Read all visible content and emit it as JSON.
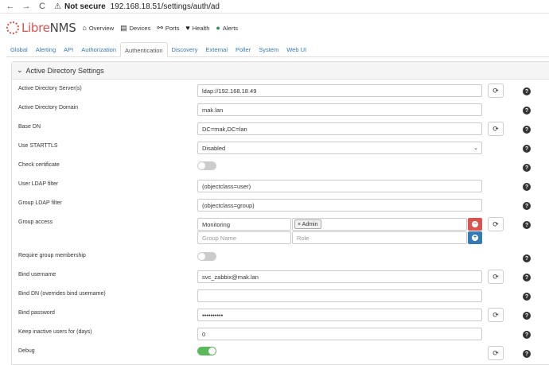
{
  "browser": {
    "back": "←",
    "forward": "→",
    "reload": "C",
    "warning_icon": "warning-icon",
    "not_secure": "Not secure",
    "url": "192.168.18.51/settings/auth/ad"
  },
  "navbar": {
    "brand_prefix": "Libre",
    "brand_suffix": "NMS",
    "items": [
      {
        "label": "Overview",
        "icon": "home-icon"
      },
      {
        "label": "Devices",
        "icon": "server-icon"
      },
      {
        "label": "Ports",
        "icon": "link-icon"
      },
      {
        "label": "Health",
        "icon": "heartbeat-icon"
      },
      {
        "label": "Alerts",
        "icon": "alert-icon"
      }
    ]
  },
  "tabs": [
    "Global",
    "Alerting",
    "API",
    "Authorization",
    "Authentication",
    "Discovery",
    "External",
    "Poller",
    "System",
    "Web UI"
  ],
  "active_tab": "Authentication",
  "panel": {
    "title": "Active Directory Settings"
  },
  "settings": {
    "ad_server": {
      "label": "Active Directory Server(s)",
      "value": "ldap://192.168.18.49"
    },
    "ad_domain": {
      "label": "Active Directory Domain",
      "value": "mak.lan"
    },
    "base_dn": {
      "label": "Base DN",
      "value": "DC=mak,DC=lan"
    },
    "starttls": {
      "label": "Use STARTTLS",
      "value": "Disabled"
    },
    "check_cert": {
      "label": "Check certificate",
      "enabled": false
    },
    "user_filter": {
      "label": "User LDAP filter",
      "value": "(objectclass=user)"
    },
    "group_filter": {
      "label": "Group LDAP filter",
      "value": "(objectclass=group)"
    },
    "group_access": {
      "label": "Group access",
      "group_value": "Monitoring",
      "role_tag": "× Admin",
      "group_placeholder": "Group Name",
      "role_placeholder": "Role"
    },
    "require_membership": {
      "label": "Require group membership",
      "enabled": false
    },
    "bind_username": {
      "label": "Bind username",
      "value": "svc_zabbix@mak.lan"
    },
    "bind_dn": {
      "label": "Bind DN (overrides bind username)",
      "value": ""
    },
    "bind_password": {
      "label": "Bind password",
      "value": "••••••••••"
    },
    "keep_inactive": {
      "label": "Keep inactive users for (days)",
      "value": "0"
    },
    "debug": {
      "label": "Debug",
      "enabled": true
    }
  },
  "colors": {
    "accent": "#337ab7",
    "danger": "#d9534f",
    "success": "#5cb85c"
  }
}
